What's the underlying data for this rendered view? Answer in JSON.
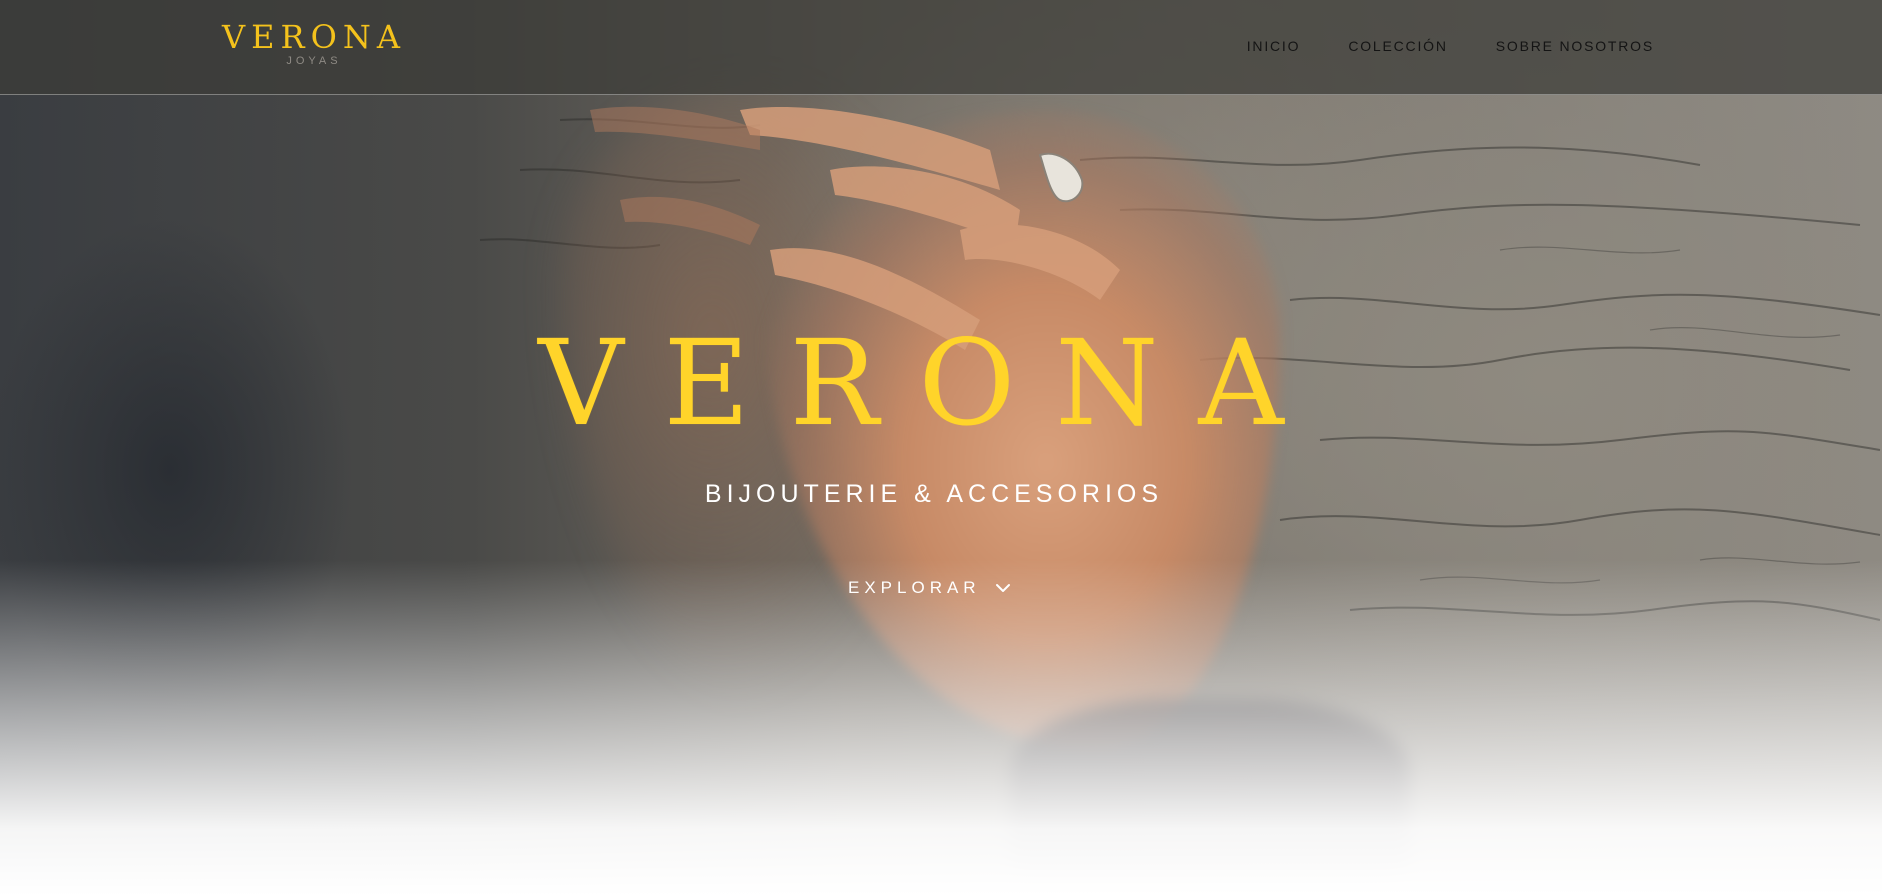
{
  "brand": {
    "name": "VERONA",
    "tagline": "JOYAS",
    "color": "#f4c21c"
  },
  "nav": {
    "items": [
      {
        "label": "INICIO"
      },
      {
        "label": "COLECCIÓN"
      },
      {
        "label": "SOBRE NOSOTROS"
      }
    ]
  },
  "hero": {
    "title": "VERONA",
    "subtitle": "BIJOUTERIE & ACCESORIOS",
    "cta_label": "EXPLORAR",
    "cta_icon": "chevron-down-icon",
    "background_image": "hand-with-ring-on-marble-photo"
  },
  "colors": {
    "accent": "#ffd42a",
    "header_bg": "#3c3c38",
    "text_light": "#ffffff",
    "nav_text": "#141414"
  }
}
